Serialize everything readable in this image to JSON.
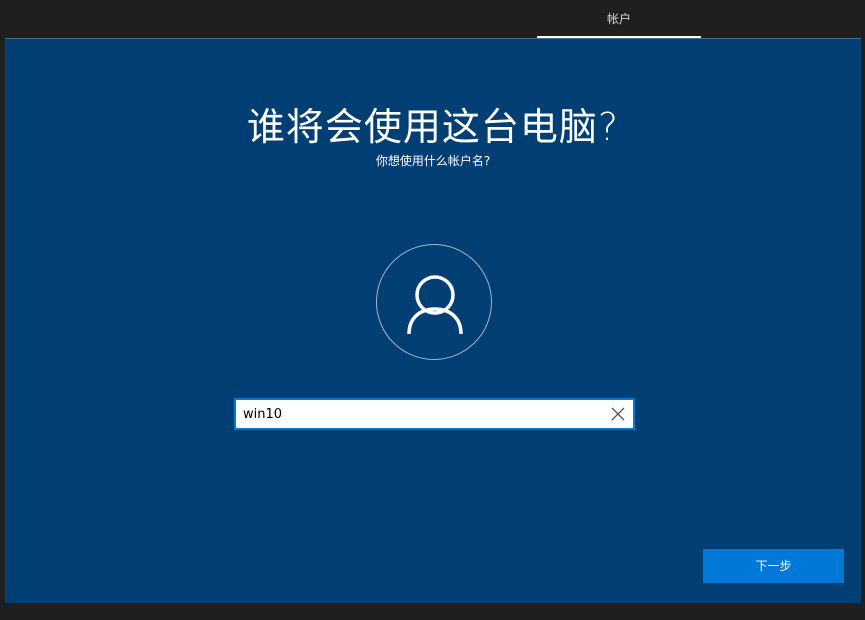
{
  "topbar": {
    "tabs": [
      {
        "label": "帐户",
        "active": true
      }
    ]
  },
  "main": {
    "title": "谁将会使用这台电脑?",
    "subtitle": "你想使用什么帐户名?",
    "avatar_icon": "user-icon",
    "username_input": {
      "value": "win10",
      "placeholder": ""
    },
    "clear_icon": "close-icon",
    "next_label": "下一步"
  },
  "bottombar": {
    "icons": [
      "ease-of-access-icon",
      "microphone-icon"
    ]
  },
  "colors": {
    "background": "#003e74",
    "accent": "#0078d7",
    "chrome": "#1f1f1f"
  }
}
